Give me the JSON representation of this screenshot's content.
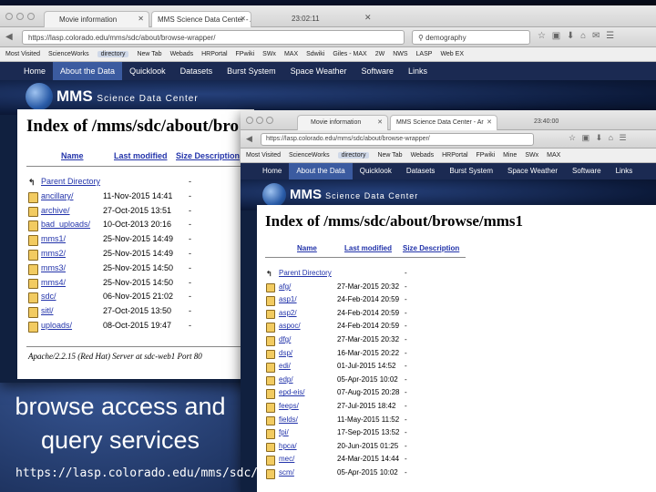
{
  "back": {
    "tabs": [
      {
        "label": "Movie information"
      },
      {
        "label": "MMS Science Data Center - Ar"
      }
    ],
    "time": "23:02:11",
    "url": "https://lasp.colorado.edu/mms/sdc/about/browse-wrapper/",
    "search": "demography",
    "bookmarks": [
      "Most Visited",
      "ScienceWorks",
      "directory",
      "New Tab",
      "Webads",
      "HRPortal",
      "FPwiki",
      "SWx",
      "MAX",
      "Sdwiki",
      "Giles - MAX",
      "2W",
      "NWS",
      "LASP",
      "Web EX"
    ],
    "menu": [
      "Home",
      "About the Data",
      "Quicklook",
      "Datasets",
      "Burst System",
      "Space Weather",
      "Software",
      "Links"
    ],
    "menu_active": "About the Data",
    "logo": {
      "main": "MMS",
      "sub": "Science Data Center"
    },
    "title": "Index of /mms/sdc/about/bro",
    "headers": {
      "name": "Name",
      "modified": "Last modified",
      "size": "Size Description"
    },
    "rows": [
      {
        "name": "Parent Directory",
        "date": "",
        "size": "-"
      },
      {
        "name": "ancillary/",
        "date": "11-Nov-2015 14:41",
        "size": "-"
      },
      {
        "name": "archive/",
        "date": "27-Oct-2015 13:51",
        "size": "-"
      },
      {
        "name": "bad_uploads/",
        "date": "10-Oct-2013 20:16",
        "size": "-"
      },
      {
        "name": "mms1/",
        "date": "25-Nov-2015 14:49",
        "size": "-"
      },
      {
        "name": "mms2/",
        "date": "25-Nov-2015 14:49",
        "size": "-"
      },
      {
        "name": "mms3/",
        "date": "25-Nov-2015 14:50",
        "size": "-"
      },
      {
        "name": "mms4/",
        "date": "25-Nov-2015 14:50",
        "size": "-"
      },
      {
        "name": "sdc/",
        "date": "06-Nov-2015 21:02",
        "size": "-"
      },
      {
        "name": "sitl/",
        "date": "27-Oct-2015 13:50",
        "size": "-"
      },
      {
        "name": "uploads/",
        "date": "08-Oct-2015 19:47",
        "size": "-"
      }
    ],
    "apache": "Apache/2.2.15 (Red Hat) Server at sdc-web1 Port 80"
  },
  "front": {
    "tabs": [
      {
        "label": "Movie information"
      },
      {
        "label": "MMS Science Data Center - Ar"
      }
    ],
    "time": "23:40:00",
    "url": "https://lasp.colorado.edu/mms/sdc/about/browse-wrapper/",
    "bookmarks": [
      "Most Visited",
      "ScienceWorks",
      "directory",
      "New Tab",
      "Webads",
      "HRPortal",
      "FPwiki",
      "Mine",
      "SWx",
      "MAX"
    ],
    "menu": [
      "Home",
      "About the Data",
      "Quicklook",
      "Datasets",
      "Burst System",
      "Space Weather",
      "Software",
      "Links"
    ],
    "menu_active": "About the Data",
    "logo": {
      "main": "MMS",
      "sub": "Science Data Center"
    },
    "title": "Index of /mms/sdc/about/browse/mms1",
    "headers": {
      "name": "Name",
      "modified": "Last modified",
      "size": "Size Description"
    },
    "rows": [
      {
        "name": "Parent Directory",
        "date": "",
        "size": "-"
      },
      {
        "name": "afg/",
        "date": "27-Mar-2015 20:32",
        "size": "-"
      },
      {
        "name": "asp1/",
        "date": "24-Feb-2014 20:59",
        "size": "-"
      },
      {
        "name": "asp2/",
        "date": "24-Feb-2014 20:59",
        "size": "-"
      },
      {
        "name": "aspoc/",
        "date": "24-Feb-2014 20:59",
        "size": "-"
      },
      {
        "name": "dfg/",
        "date": "27-Mar-2015 20:32",
        "size": "-"
      },
      {
        "name": "dsp/",
        "date": "16-Mar-2015 20:22",
        "size": "-"
      },
      {
        "name": "edi/",
        "date": "01-Jul-2015 14:52",
        "size": "-"
      },
      {
        "name": "edp/",
        "date": "05-Apr-2015 10:02",
        "size": "-"
      },
      {
        "name": "epd-eis/",
        "date": "07-Aug-2015 20:28",
        "size": "-"
      },
      {
        "name": "feeps/",
        "date": "27-Jul-2015 18:42",
        "size": "-"
      },
      {
        "name": "fields/",
        "date": "11-May-2015 11:52",
        "size": "-"
      },
      {
        "name": "fpi/",
        "date": "17-Sep-2015 13:52",
        "size": "-"
      },
      {
        "name": "hpca/",
        "date": "20-Jun-2015 01:25",
        "size": "-"
      },
      {
        "name": "mec/",
        "date": "24-Mar-2015 14:44",
        "size": "-"
      },
      {
        "name": "scm/",
        "date": "05-Apr-2015 10:02",
        "size": "-"
      }
    ]
  },
  "caption": {
    "line1": "browse access and",
    "line2": "query services",
    "link": "https://lasp.colorado.edu/mms/sdc/"
  }
}
